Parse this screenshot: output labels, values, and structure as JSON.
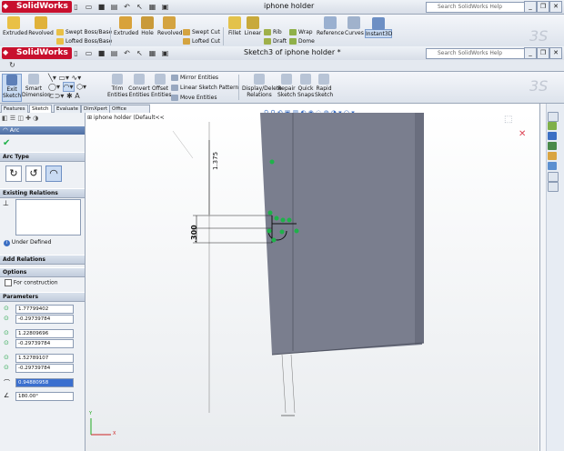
{
  "app": {
    "brand": "SolidWorks",
    "document_title": "iphone holder",
    "help_search_placeholder": "Search SolidWorks Help",
    "minimize": "_",
    "restore": "❐",
    "close": "✕"
  },
  "window2": {
    "document_title": "Sketch3 of iphone holder *",
    "help_search_placeholder": "Search SolidWorks Help"
  },
  "features_ribbon": {
    "extruded": "Extruded",
    "revolved": "Revolved",
    "swept_boss": "Swept Boss/Base",
    "lofted_boss": "Lofted Boss/Base",
    "extruded_cut": "Extruded",
    "hole": "Hole",
    "revolved_cut": "Revolved",
    "swept_cut": "Swept Cut",
    "lofted_cut": "Lofted Cut",
    "fillet": "Fillet",
    "linear": "Linear",
    "rib": "Rib",
    "draft": "Draft",
    "wrap": "Wrap",
    "dome": "Dome",
    "reference": "Reference",
    "curves": "Curves",
    "instant3d": "Instant3D"
  },
  "sketch_ribbon": {
    "exit_sketch": "Exit Sketch",
    "smart_dimension": "Smart Dimension",
    "trim": "Trim Entities",
    "convert": "Convert Entities",
    "offset": "Offset Entities",
    "mirror": "Mirror Entities",
    "linear_pattern": "Linear Sketch Pattern",
    "move": "Move Entities",
    "display_delete": "Display/Delete Relations",
    "repair": "Repair Sketch",
    "quick_snaps": "Quick Snaps",
    "rapid_sketch": "Rapid Sketch"
  },
  "tabs": [
    "Features",
    "Sketch",
    "Evaluate",
    "DimXpert",
    "Office Products"
  ],
  "tree_label": "iphone holder (Default<<",
  "property_manager": {
    "title": "Arc",
    "arc_type": "Arc Type",
    "existing_relations": "Existing Relations",
    "under_defined": "Under Defined",
    "add_relations": "Add Relations",
    "options": "Options",
    "for_construction": "For construction",
    "parameters": "Parameters",
    "values": [
      "1.77799402",
      "-0.29739784",
      "1.22809696",
      "-0.29739784",
      "1.52789107",
      "-0.29739784",
      "0.94880958",
      "180.00°"
    ]
  },
  "dimensions": {
    "d1": "1.375",
    "d2": ".300"
  },
  "triad": {
    "x": "X",
    "y": "Y"
  },
  "colors": {
    "accent_red": "#c8102e",
    "part_face": "#7a7e8e",
    "sketch_green": "#1fb24a"
  }
}
